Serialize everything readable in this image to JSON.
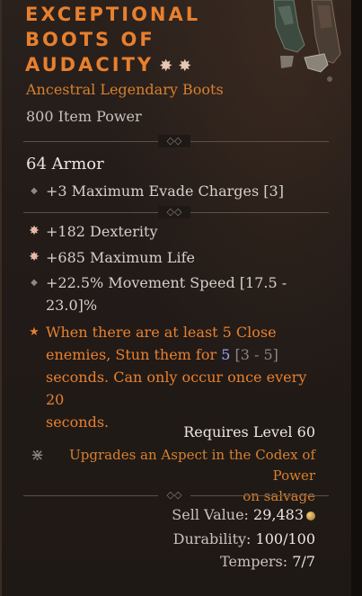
{
  "item": {
    "name_lines": [
      "EXCEPTIONAL",
      "BOOTS OF",
      "AUDACITY"
    ],
    "type": "Ancestral Legendary Boots",
    "power": "800 Item Power",
    "icon": "boots-portrait-icon",
    "socket_icons": [
      "socket-gem-icon",
      "socket-gem-icon"
    ]
  },
  "armor": "64 Armor",
  "implicit": {
    "text": "+3 Maximum Evade Charges [3]"
  },
  "affixes": [
    {
      "bullet": "greater-affix-icon",
      "text": "+182 Dexterity"
    },
    {
      "bullet": "greater-affix-icon",
      "text": "+685 Maximum Life"
    },
    {
      "bullet": "diamond-bullet-icon",
      "line1": "+22.5% Movement Speed [17.5 -",
      "line2": "23.0]%"
    }
  ],
  "aspect": {
    "bullet": "legendary-star-icon",
    "line1": "When there are at least 5 Close",
    "line2_pre": "enemies, Stun them for ",
    "line2_value": "5",
    "line2_range": " [3 - 5]",
    "line3": "seconds. Can only occur once every 20",
    "line4": "seconds."
  },
  "requirement": "Requires Level 60",
  "upgrade": {
    "icon": "codex-upgrade-icon",
    "line1": "Upgrades an Aspect in the Codex of Power",
    "line2": "on salvage"
  },
  "footer": {
    "sell_label": "Sell Value:",
    "sell_value": "29,483",
    "gold_icon": "gold-coin-icon",
    "durability_label": "Durability:",
    "durability_value": "100/100",
    "tempers_label": "Tempers:",
    "tempers_value": "7/7"
  },
  "colors": {
    "legendary": "#e8802e",
    "text": "#d6d0ca",
    "bracket_range": "#8c8782",
    "value_highlight": "#9aa2ff"
  }
}
